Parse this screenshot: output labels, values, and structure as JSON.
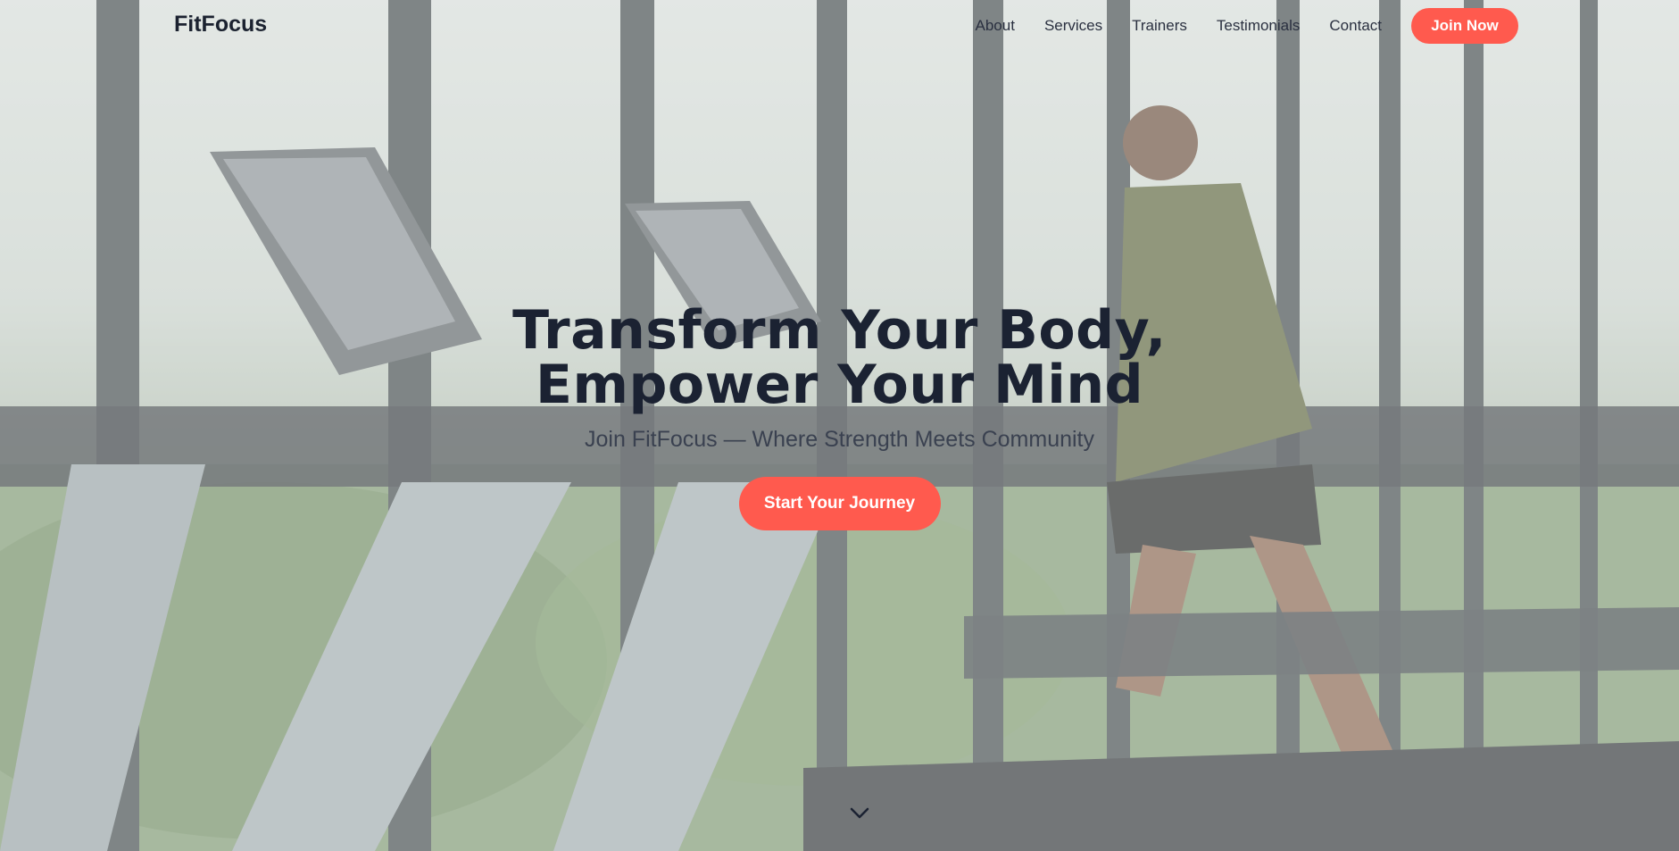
{
  "brand": {
    "logo": "FitFocus"
  },
  "nav": {
    "links": [
      "About",
      "Services",
      "Trainers",
      "Testimonials",
      "Contact"
    ],
    "join_label": "Join Now"
  },
  "hero": {
    "title_line1": "Transform Your Body,",
    "title_line2": "Empower Your Mind",
    "subtitle": "Join FitFocus — Where Strength Meets Community",
    "cta_label": "Start Your Journey",
    "scroll_icon": "chevron-down-icon",
    "background_image": "treadmill-gym-runner-photo"
  },
  "colors": {
    "accent": "#ff5a4e",
    "heading": "#1b2232",
    "text": "#2a3040"
  }
}
